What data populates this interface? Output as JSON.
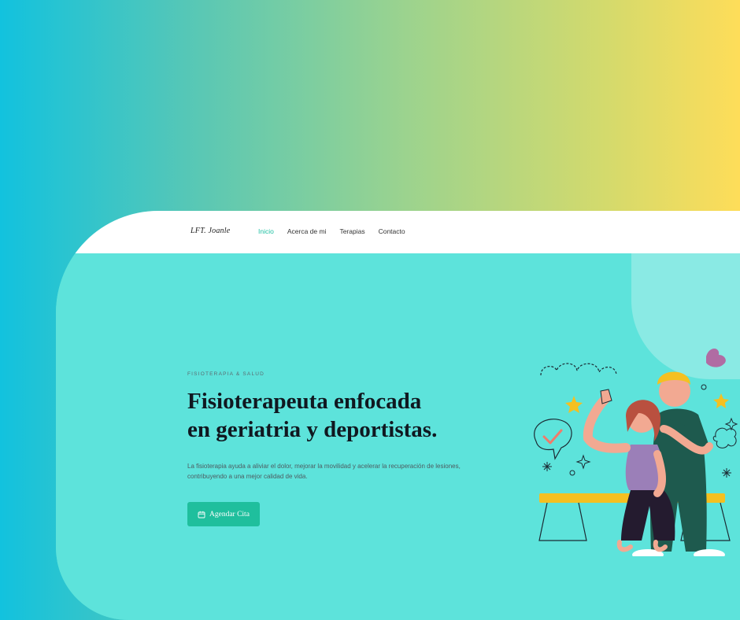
{
  "brand": {
    "logo_text": "LFT. Joanle"
  },
  "nav": {
    "items": [
      {
        "label": "Inicio",
        "active": true
      },
      {
        "label": "Acerca de mi",
        "active": false
      },
      {
        "label": "Terapias",
        "active": false
      },
      {
        "label": "Contacto",
        "active": false
      }
    ]
  },
  "hero": {
    "kicker": "FISIOTERAPIA & SALUD",
    "headline_line1": "Fisioterapeuta enfocada",
    "headline_line2": "en geriatria y deportistas.",
    "lead": "La fisioterapia ayuda a aliviar el dolor, mejorar la movilidad y acelerar la recuperación de lesiones, contribuyendo a una mejor calidad de vida.",
    "cta_label": "Agendar Cita",
    "cta_icon": "calendar-icon",
    "illustration": "physiotherapist-with-patient-illustration"
  },
  "colors": {
    "accent": "#1fbf9d",
    "hero_bg": "#5de3db",
    "gradient_start": "#12c2de",
    "gradient_end": "#fedd59"
  }
}
